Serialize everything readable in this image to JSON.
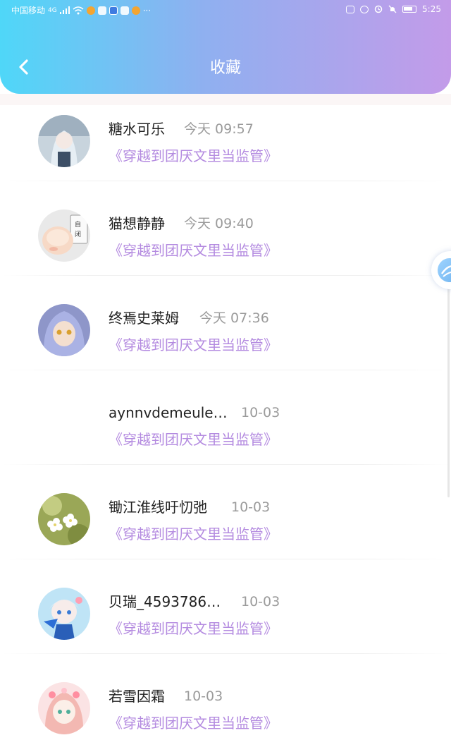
{
  "status_bar": {
    "carrier": "中国移动",
    "network": "4G",
    "time": "5:25"
  },
  "header": {
    "title": "收藏"
  },
  "favorites": [
    {
      "name": "糖水可乐",
      "time": "今天 09:57",
      "book": "《穿越到团厌文里当监管》"
    },
    {
      "name": "猫想静静",
      "time": "今天 09:40",
      "book": "《穿越到团厌文里当监管》"
    },
    {
      "name": "终焉史莱姆",
      "time": "今天 07:36",
      "book": "《穿越到团厌文里当监管》"
    },
    {
      "name": "aynnvdemeule…",
      "time": "10-03",
      "book": "《穿越到团厌文里当监管》"
    },
    {
      "name": "锄江淮线吁忉弛",
      "time": "10-03",
      "book": "《穿越到团厌文里当监管》"
    },
    {
      "name": "贝瑞_4593786…",
      "time": "10-03",
      "book": "《穿越到团厌文里当监管》"
    },
    {
      "name": "若雪因霜",
      "time": "10-03",
      "book": "《穿越到团厌文里当监管》"
    }
  ],
  "colors": {
    "header_gradient_start": "#4fd7f8",
    "header_gradient_end": "#c39be9",
    "book_link": "#b48be0",
    "time_text": "#9b9b9b"
  }
}
